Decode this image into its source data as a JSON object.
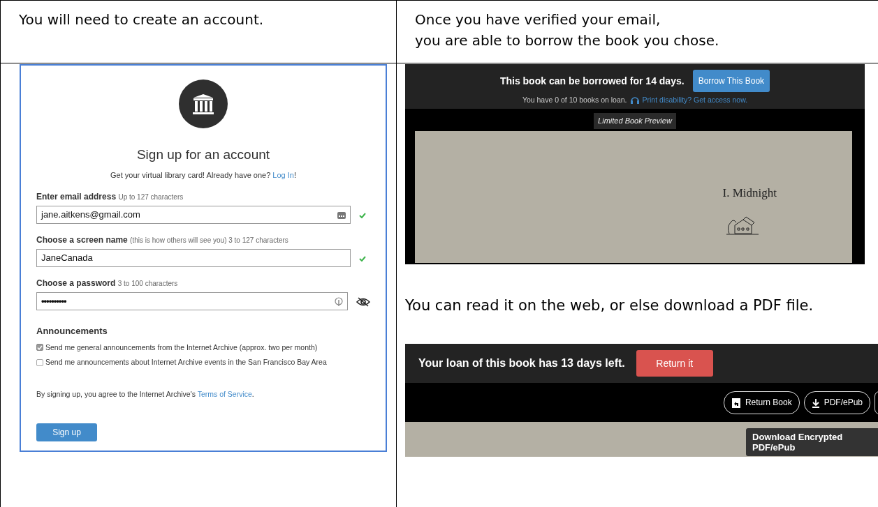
{
  "header_row": [
    "You will need to create an account.",
    "Once you have verified your email,\nyou are able to borrow the book you chose."
  ],
  "signup": {
    "title": "Sign up for an account",
    "subtitle": "Get your virtual library card! Already have one? ",
    "login_link": "Log In",
    "subtitle_end": "!",
    "fields": [
      {
        "label": "Enter email address",
        "hint": "Up to 127 characters",
        "value": "jane.aitkens@gmail.com",
        "kind": "email",
        "valid": true
      },
      {
        "label": "Choose a screen name",
        "hint": "(this is how others will see you) 3 to 127 characters",
        "value": "JaneCanada",
        "kind": "text",
        "valid": true
      },
      {
        "label": "Choose a password",
        "hint": "3 to 100 characters",
        "value": "••••••••••",
        "kind": "password",
        "valid": false
      }
    ],
    "announcements_heading": "Announcements",
    "options": [
      {
        "label": "Send me general announcements from the Internet Archive (approx. two per month)",
        "checked": true
      },
      {
        "label": "Send me announcements about Internet Archive events in the San Francisco Bay Area",
        "checked": false
      }
    ],
    "terms_text": "By signing up, you agree to the Internet Archive's ",
    "terms_link": "Terms of Service",
    "terms_end": ".",
    "button": "Sign up"
  },
  "borrow": {
    "headline": "This book can be borrowed for 14 days.",
    "button": "Borrow This Book",
    "loan_count": "You have 0 of 10 books on loan.",
    "access_link": "Print disability? Get access now.",
    "preview_label": "Limited Book Preview",
    "page_heading": "I. Midnight"
  },
  "middle_text": "You can read it on the web, or else download a PDF file.",
  "loan": {
    "headline": "Your loan of this book has 13 days left.",
    "button": "Return it",
    "actions": [
      {
        "label": "Return Book",
        "kind": "return"
      },
      {
        "label": "PDF/ePub",
        "kind": "download"
      }
    ],
    "tooltip": "Download Encrypted PDF/ePub"
  }
}
